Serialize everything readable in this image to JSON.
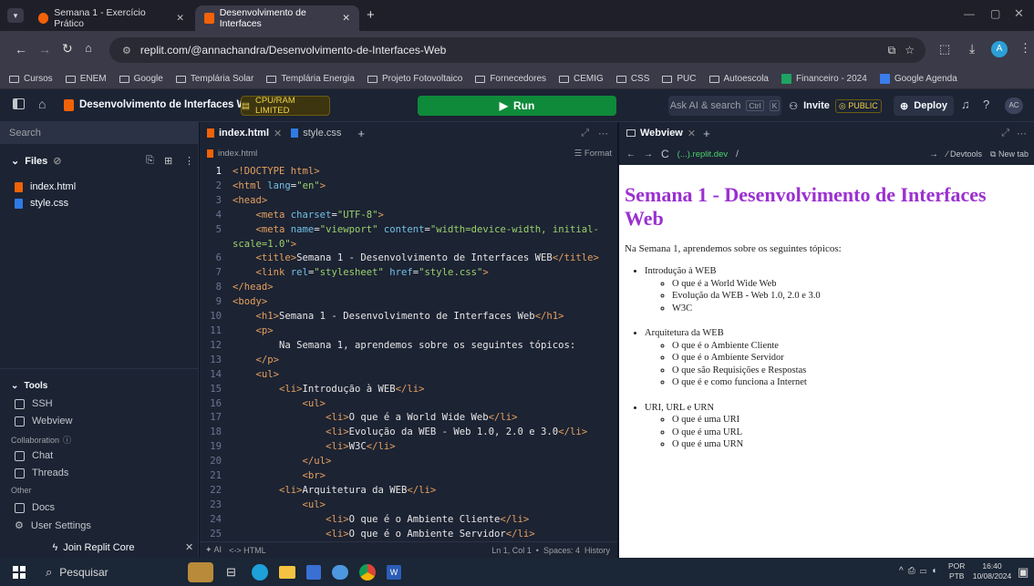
{
  "browser": {
    "tabs": [
      {
        "label": "Semana 1 - Exercício Prático"
      },
      {
        "label": "Desenvolvimento de Interfaces"
      }
    ],
    "url": "replit.com/@annachandra/Desenvolvimento-de-Interfaces-Web",
    "bookmarks": [
      "Cursos",
      "ENEM",
      "Google",
      "Templária Solar",
      "Templária Energia",
      "Projeto Fotovoltaico",
      "Fornecedores",
      "CEMIG",
      "CSS",
      "PUC",
      "Autoescola",
      "Financeiro - 2024",
      "Google Agenda"
    ]
  },
  "replit": {
    "project": "Desenvolvimento de Interfaces Web",
    "cpu_badge": "CPU/RAM LIMITED",
    "run": "Run",
    "ask_ai": "Ask AI & search",
    "kbd1": "Ctrl",
    "kbd2": "K",
    "invite": "Invite",
    "public": "PUBLIC",
    "deploy": "Deploy",
    "avatar": "AC"
  },
  "sidebar": {
    "search": "Search",
    "files_header": "Files",
    "files": [
      "index.html",
      "style.css"
    ],
    "tools_header": "Tools",
    "tools": [
      "SSH",
      "Webview"
    ],
    "collab_header": "Collaboration",
    "collab": [
      "Chat",
      "Threads"
    ],
    "other_header": "Other",
    "other": [
      "Docs",
      "User Settings"
    ],
    "join": "Join Replit Core"
  },
  "editor": {
    "tabs": [
      "index.html",
      "style.css"
    ],
    "file_crumb": "index.html",
    "format": "Format",
    "status_left": "AI",
    "status_lang": "HTML",
    "status_right": "Ln 1, Col 1  •  Spaces: 4  History"
  },
  "webview": {
    "tab": "Webview",
    "url_host": "(...).replit.dev",
    "url_path": "/",
    "devtools": "Devtools",
    "newtab": "New tab",
    "h1": "Semana 1 - Desenvolvimento de Interfaces Web",
    "intro": "Na Semana 1, aprendemos sobre os seguintes tópicos:",
    "sections": [
      {
        "title": "Introdução à WEB",
        "items": [
          "O que é a World Wide Web",
          "Evolução da WEB - Web 1.0, 2.0 e 3.0",
          "W3C"
        ]
      },
      {
        "title": "Arquitetura da WEB",
        "items": [
          "O que é o Ambiente Cliente",
          "O que é o Ambiente Servidor",
          "O que são Requisições e Respostas",
          "O que é e como funciona a Internet"
        ]
      },
      {
        "title": "URI, URL e URN",
        "items": [
          "O que é uma URI",
          "O que é uma URL",
          "O que é uma URN"
        ]
      }
    ]
  },
  "taskbar": {
    "search": "Pesquisar",
    "lang1": "POR",
    "lang2": "PTB",
    "time": "16:40",
    "date": "10/08/2024"
  }
}
